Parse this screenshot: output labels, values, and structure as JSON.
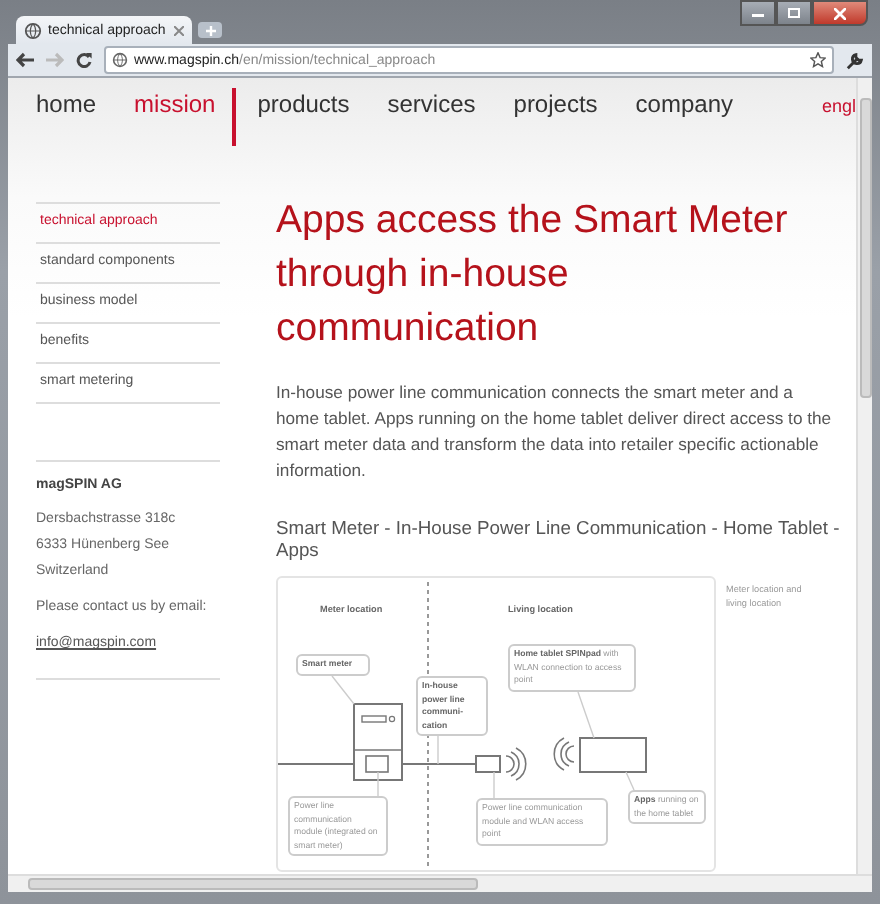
{
  "browser": {
    "tab_title": "technical approach",
    "url_host": "www.magspin.ch",
    "url_path": "/en/mission/technical_approach"
  },
  "nav": {
    "items": [
      {
        "label": "home",
        "selected": false
      },
      {
        "label": "mission",
        "selected": true
      },
      {
        "label": "products",
        "selected": false
      },
      {
        "label": "services",
        "selected": false
      },
      {
        "label": "projects",
        "selected": false
      },
      {
        "label": "company",
        "selected": false
      }
    ],
    "language": "engl"
  },
  "sidebar": {
    "items": [
      {
        "label": "technical approach",
        "selected": true
      },
      {
        "label": "standard components",
        "selected": false
      },
      {
        "label": "business model",
        "selected": false
      },
      {
        "label": "benefits",
        "selected": false
      },
      {
        "label": "smart metering",
        "selected": false
      }
    ],
    "company": "magSPIN AG",
    "address": [
      "Dersbachstrasse 318c",
      "6333 Hünenberg See",
      "Switzerland"
    ],
    "contact_text": "Please contact us by email:",
    "email": "info@magspin.com"
  },
  "content": {
    "heading": "Apps access the Smart Meter through in-house communication",
    "intro": "In-house power line communication connects the smart meter and a home tablet. Apps running on the home tablet deliver direct access to the smart meter data and transform the data into retailer specific actionable information.",
    "figure_title": "Smart Meter - In-House Power Line Communication - Home Tablet - Apps",
    "figure": {
      "zones": [
        "Meter location",
        "Living location"
      ],
      "callouts": [
        {
          "kind": "smart_meter",
          "text": "Smart meter"
        },
        {
          "kind": "plc_line",
          "text": "In-house power line communi-cation"
        },
        {
          "kind": "tablet",
          "text": "**Home tablet SPINpad** with WLAN connection to access point"
        },
        {
          "kind": "meter_module",
          "text": "Power line communication module (integrated on smart meter)"
        },
        {
          "kind": "access_point",
          "text": "Power line communication module and WLAN access point"
        },
        {
          "kind": "apps",
          "text": "**Apps** running on the home tablet"
        }
      ]
    },
    "caption": "Meter location and living location"
  }
}
